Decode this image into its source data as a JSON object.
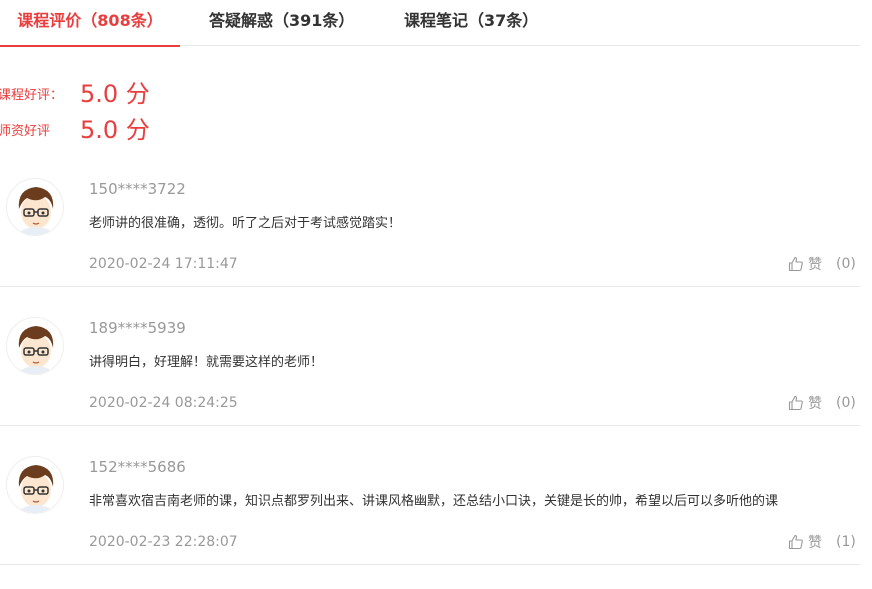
{
  "tabs": [
    {
      "label": "课程评价（808条）",
      "active": true
    },
    {
      "label": "答疑解惑（391条）",
      "active": false
    },
    {
      "label": "课程笔记（37条）",
      "active": false
    }
  ],
  "ratings": [
    {
      "label": "课程好评：",
      "value": "5.0 分"
    },
    {
      "label": "师资好评",
      "value": "5.0 分"
    }
  ],
  "comments": [
    {
      "username": "150****3722",
      "content": "老师讲的很准确，透彻。听了之后对于考试感觉踏实！",
      "time": "2020-02-24 17:11:47",
      "like_label": "赞",
      "like_count": "(0)"
    },
    {
      "username": "189****5939",
      "content": "讲得明白，好理解！就需要这样的老师！",
      "time": "2020-02-24 08:24:25",
      "like_label": "赞",
      "like_count": "(0)"
    },
    {
      "username": "152****5686",
      "content": "非常喜欢宿吉南老师的课，知识点都罗列出来、讲课风格幽默，还总结小口诀，关键是长的帅，希望以后可以多听他的课",
      "time": "2020-02-23 22:28:07",
      "like_label": "赞",
      "like_count": "(1)"
    }
  ],
  "colors": {
    "accent": "#e83e3e",
    "muted": "#999999"
  },
  "icons": {
    "avatar": "cartoon-boy-avatar-icon",
    "like": "thumbs-up-icon"
  }
}
